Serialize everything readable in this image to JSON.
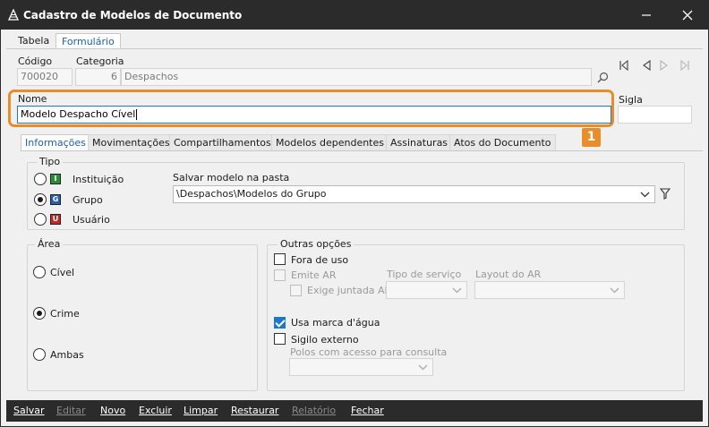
{
  "window": {
    "title": "Cadastro de Modelos de Documento"
  },
  "top_tabs": [
    {
      "label": "Tabela",
      "active": false
    },
    {
      "label": "Formulário",
      "active": true
    }
  ],
  "codigo": {
    "label": "Código",
    "value": "700020"
  },
  "categoria": {
    "label": "Categoria",
    "number": "6",
    "name": "Despachos"
  },
  "nome": {
    "label": "Nome",
    "value": "Modelo Despacho Cível"
  },
  "sigla": {
    "label": "Sigla",
    "value": ""
  },
  "callout": "1",
  "sub_tabs": [
    {
      "label": "Informações",
      "active": true
    },
    {
      "label": "Movimentações",
      "active": false
    },
    {
      "label": "Compartilhamentos",
      "active": false
    },
    {
      "label": "Modelos dependentes",
      "active": false
    },
    {
      "label": "Assinaturas",
      "active": false
    },
    {
      "label": "Atos do Documento",
      "active": false
    }
  ],
  "tipo": {
    "title": "Tipo",
    "options": [
      {
        "label": "Instituição",
        "icon_letter": "I",
        "icon_color": "#2e8b3a",
        "checked": false
      },
      {
        "label": "Grupo",
        "icon_letter": "G",
        "icon_color": "#2a5fa8",
        "checked": true
      },
      {
        "label": "Usuário",
        "icon_letter": "U",
        "icon_color": "#c62828",
        "checked": false
      }
    ]
  },
  "pasta": {
    "label": "Salvar modelo na pasta",
    "value": "\\Despachos\\Modelos do Grupo"
  },
  "area": {
    "title": "Área",
    "options": [
      {
        "label": "Cível",
        "checked": false
      },
      {
        "label": "Crime",
        "checked": true
      },
      {
        "label": "Ambas",
        "checked": false
      }
    ]
  },
  "outras": {
    "title": "Outras opções",
    "fora_de_uso": {
      "label": "Fora de uso",
      "checked": false
    },
    "emite_ar": {
      "label": "Emite AR",
      "checked": false
    },
    "exige_ar": {
      "label": "Exige juntada AR",
      "checked": false
    },
    "tipo_servico_label": "Tipo de serviço",
    "layout_ar_label": "Layout do AR",
    "marca_agua": {
      "label": "Usa marca d'água",
      "checked": true
    },
    "sigilo": {
      "label": "Sigilo externo",
      "checked": false
    },
    "polos_label": "Polos com acesso para consulta"
  },
  "bottom_buttons": [
    {
      "label": "Salvar",
      "enabled": true
    },
    {
      "label": "Editar",
      "enabled": false
    },
    {
      "label": "Novo",
      "enabled": true
    },
    {
      "label": "Excluir",
      "enabled": true
    },
    {
      "label": "Limpar",
      "enabled": true
    },
    {
      "label": "Restaurar",
      "enabled": true
    },
    {
      "label": "Relatório",
      "enabled": false
    },
    {
      "label": "Fechar",
      "enabled": true
    }
  ],
  "icons": {
    "app": "document-tree-icon",
    "minimize": "minimize-icon",
    "close": "close-icon",
    "search": "search-icon",
    "nav": [
      "first-record-icon",
      "previous-record-icon",
      "next-record-icon",
      "last-record-icon"
    ],
    "filter": "filter-icon"
  }
}
